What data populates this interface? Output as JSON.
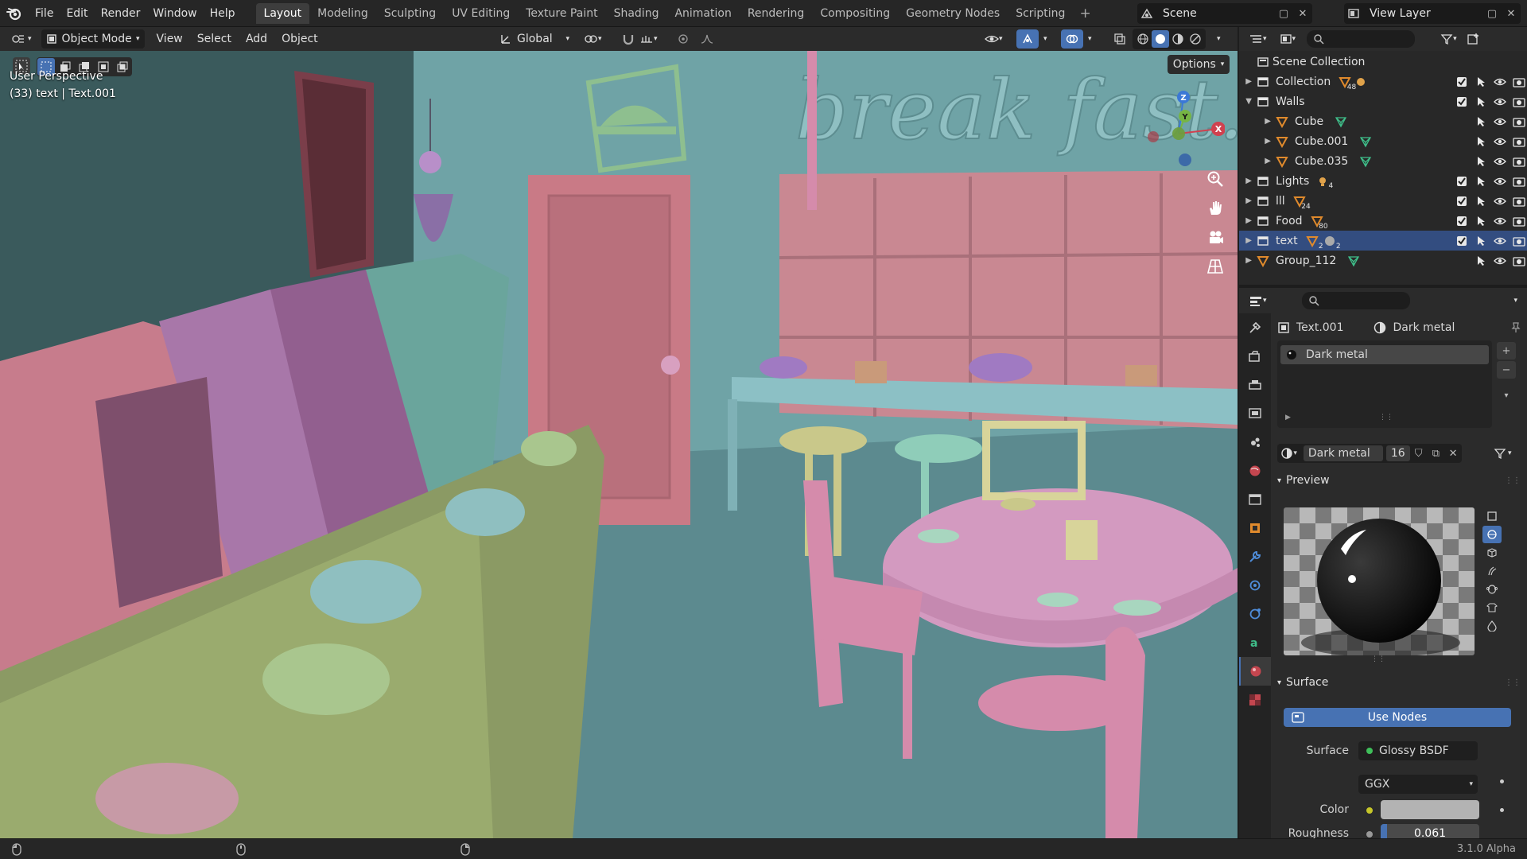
{
  "topbar": {
    "menus": [
      "File",
      "Edit",
      "Render",
      "Window",
      "Help"
    ],
    "workspaces": [
      "Layout",
      "Modeling",
      "Sculpting",
      "UV Editing",
      "Texture Paint",
      "Shading",
      "Animation",
      "Rendering",
      "Compositing",
      "Geometry Nodes",
      "Scripting"
    ],
    "active_workspace": "Layout",
    "scene": "Scene",
    "view_layer": "View Layer"
  },
  "viewport_header": {
    "mode": "Object Mode",
    "menus": [
      "View",
      "Select",
      "Add",
      "Object"
    ],
    "orientation": "Global"
  },
  "viewport": {
    "perspective_label": "User Perspective",
    "object_info": "(33) text | Text.001",
    "options_label": "Options",
    "scene_sign_text": "break fast.",
    "gizmo_axes": {
      "x": "X",
      "y": "Y",
      "z": "Z"
    }
  },
  "outliner": {
    "root": "Scene Collection",
    "rows": [
      {
        "name": "Collection",
        "badge": "48",
        "extra_badge": "",
        "level": 1
      },
      {
        "name": "Walls",
        "badge": "",
        "extra_badge": "",
        "level": 1,
        "expanded": true
      },
      {
        "name": "Cube",
        "badge": "",
        "extra_badge": "",
        "level": 2
      },
      {
        "name": "Cube.001",
        "badge": "",
        "extra_badge": "",
        "level": 2
      },
      {
        "name": "Cube.035",
        "badge": "",
        "extra_badge": "",
        "level": 2
      },
      {
        "name": "Lights",
        "badge": "4",
        "extra_badge": "",
        "level": 1
      },
      {
        "name": "lll",
        "badge": "24",
        "extra_badge": "",
        "level": 1
      },
      {
        "name": "Food",
        "badge": "80",
        "extra_badge": "",
        "level": 1
      },
      {
        "name": "text",
        "badge": "2",
        "extra_badge": "2",
        "level": 1,
        "selected": true
      },
      {
        "name": "Group_112",
        "badge": "",
        "extra_badge": "",
        "level": 1
      }
    ]
  },
  "properties": {
    "object_name": "Text.001",
    "material_name": "Dark metal",
    "slot_name": "Dark metal",
    "users_count": "16",
    "preview_label": "Preview",
    "surface_label": "Surface",
    "use_nodes_label": "Use Nodes",
    "surface_field_label": "Surface",
    "surface_value": "Glossy BSDF",
    "distribution_value": "GGX",
    "color_label": "Color",
    "roughness_label": "Roughness",
    "roughness_value": "0.061"
  },
  "statusbar": {
    "version": "3.1.0 Alpha"
  },
  "colors": {
    "accent": "#4772b3",
    "selected_row": "#334d80"
  }
}
